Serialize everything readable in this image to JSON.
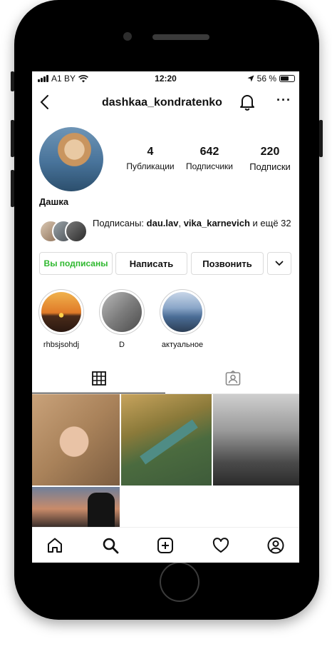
{
  "status_bar": {
    "carrier": "A1 BY",
    "time": "12:20",
    "battery": "56 %"
  },
  "header": {
    "username": "dashkaa_kondratenko",
    "more": "···"
  },
  "profile": {
    "posts": {
      "count": "4",
      "label": "Публикации"
    },
    "followers": {
      "count": "642",
      "label": "Подписчики"
    },
    "following": {
      "count": "220",
      "label": "Подписки"
    },
    "name": "Дашка",
    "followed_by": {
      "prefix": "Подписаны: ",
      "user1": "dau.lav",
      "sep": ", ",
      "user2": "vika_karnevich",
      "suffix": " и ещё 32"
    }
  },
  "actions": {
    "following_label": "Вы подписаны",
    "message_label": "Написать",
    "call_label": "Позвонить",
    "following_color": "#2eb82e"
  },
  "highlights": [
    {
      "label": "rhbsjsohdj"
    },
    {
      "label": "D"
    },
    {
      "label": "актуальное"
    }
  ],
  "tabs": [
    {
      "name": "grid-icon",
      "active": true
    },
    {
      "name": "tagged-icon",
      "active": false
    }
  ],
  "bottom_nav": [
    "home-icon",
    "search-icon",
    "add-icon",
    "heart-icon",
    "profile-icon"
  ]
}
